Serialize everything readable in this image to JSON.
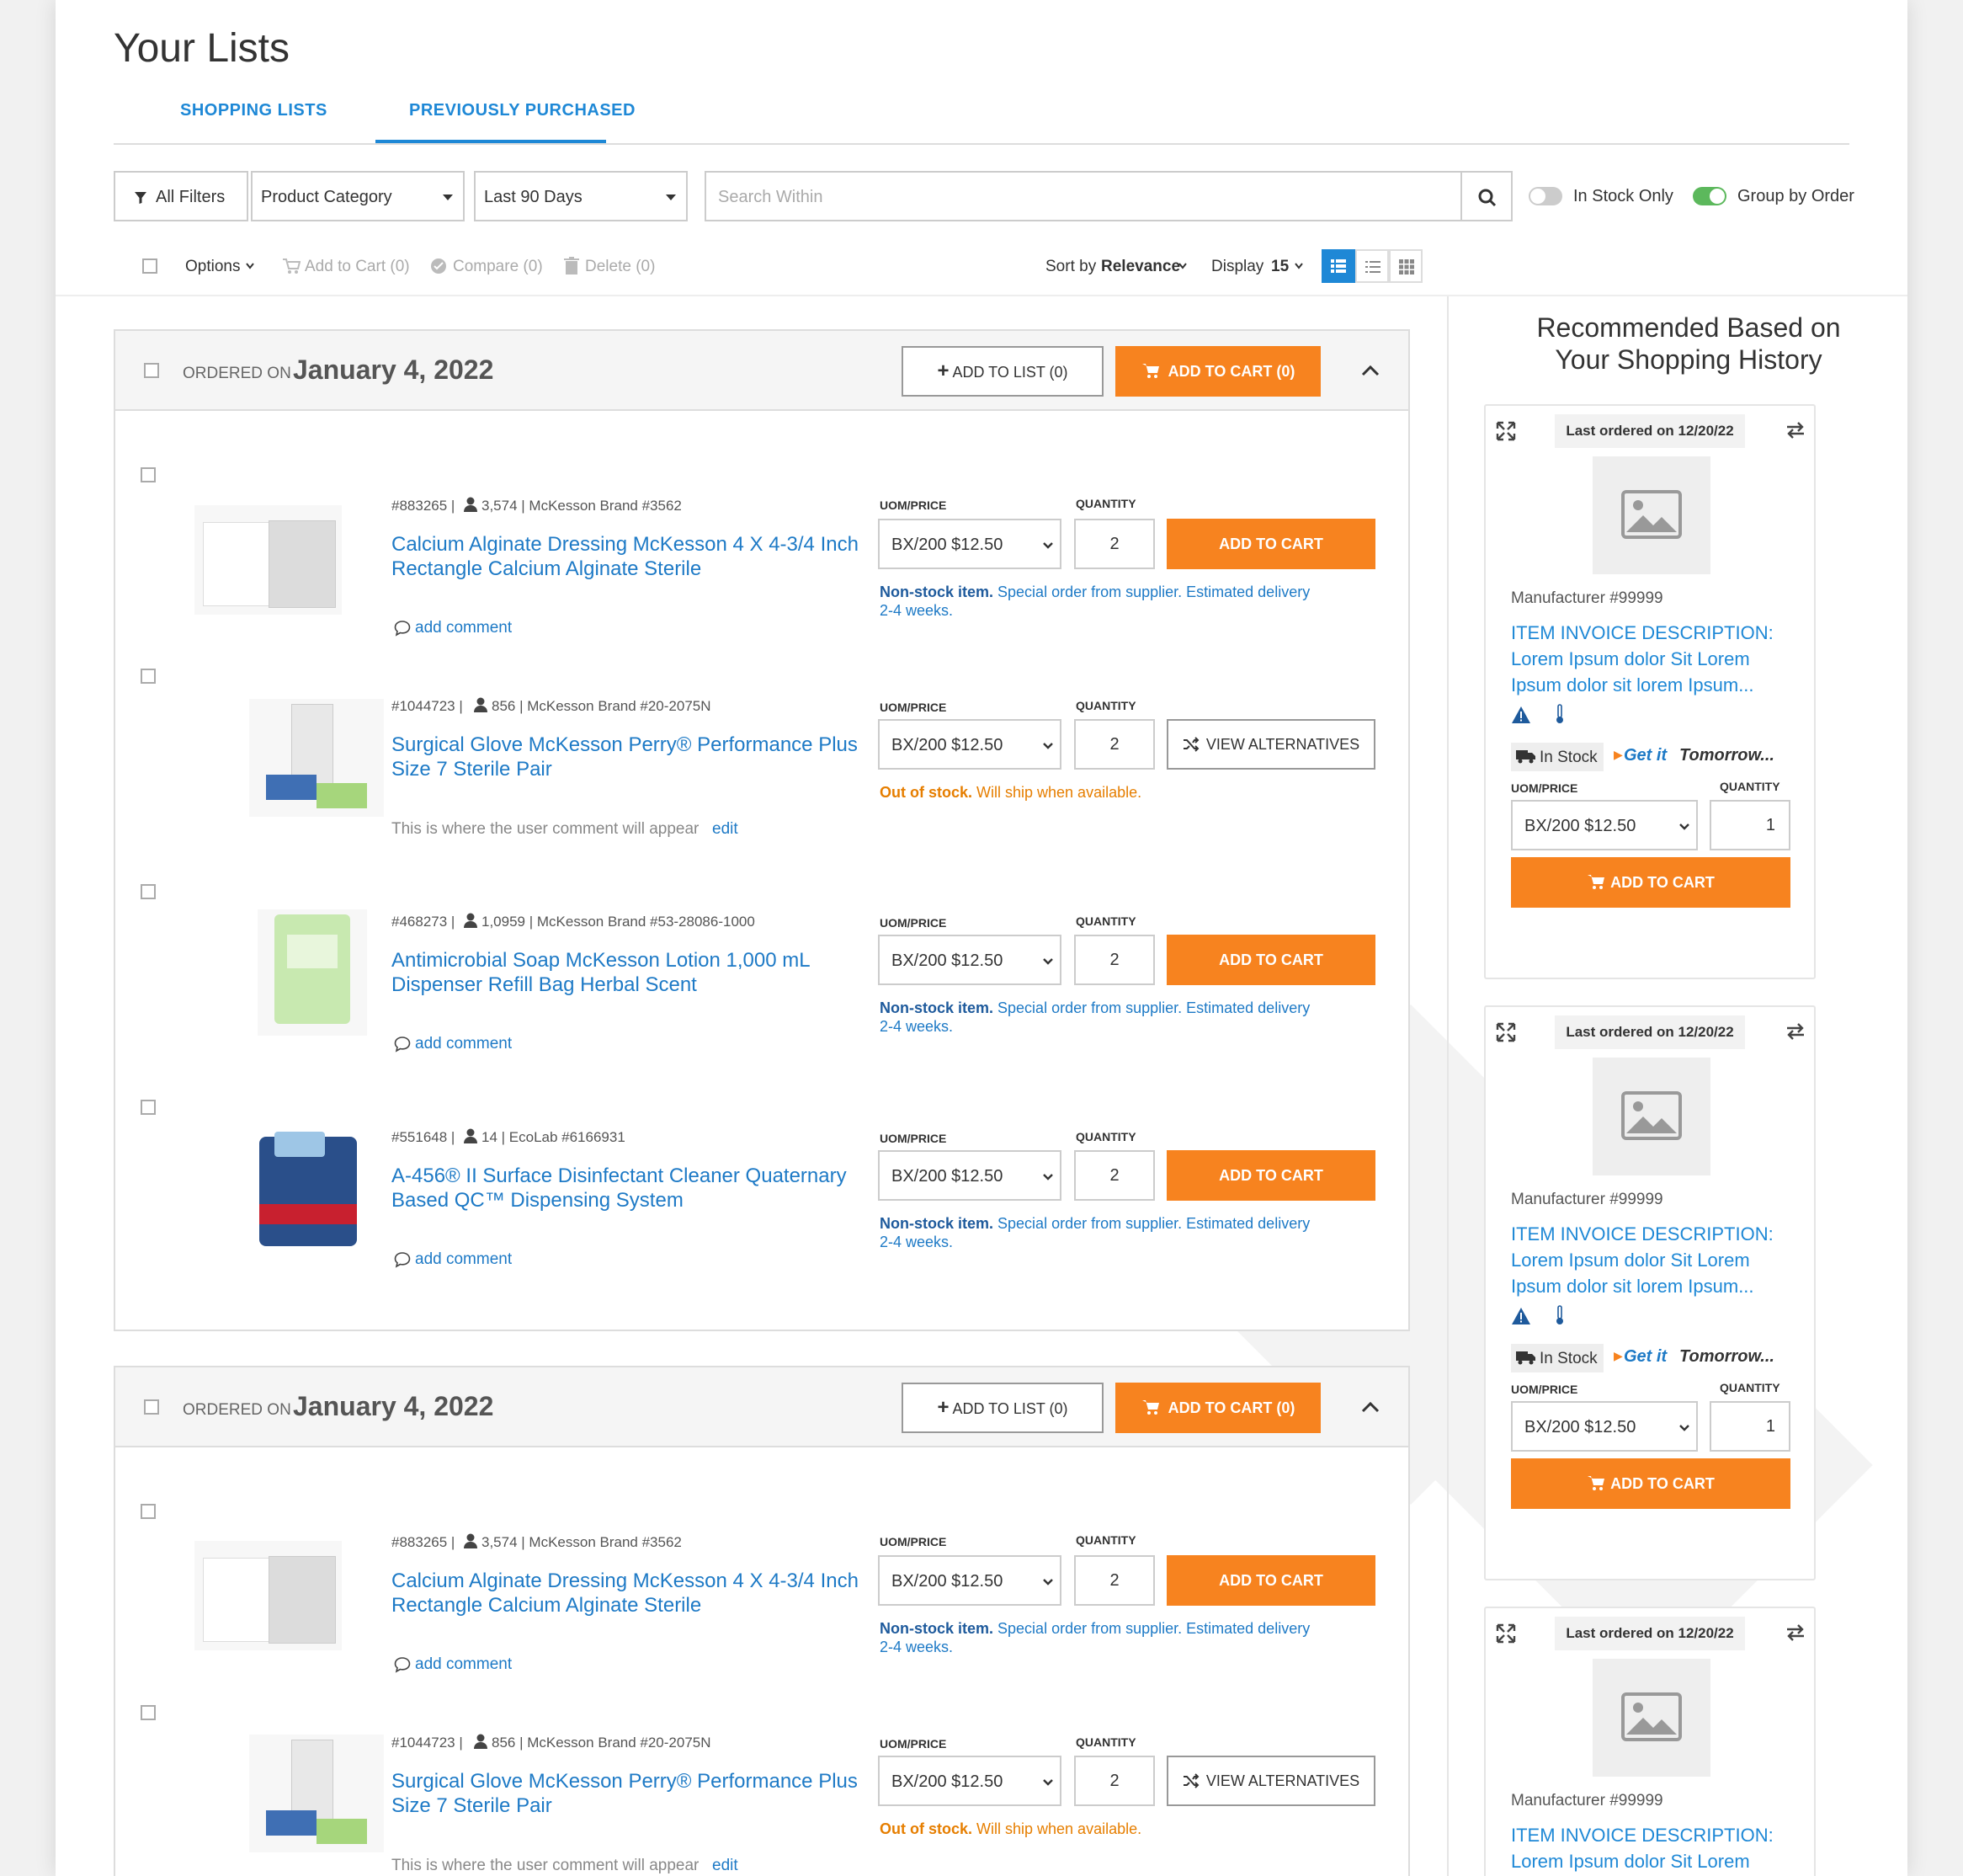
{
  "page": {
    "title": "Your Lists",
    "tabs": [
      {
        "label": "SHOPPING LISTS"
      },
      {
        "label": "PREVIOUSLY PURCHASED"
      }
    ]
  },
  "filters": {
    "all_filters": "All Filters",
    "category": "Product Category",
    "date_range": "Last 90 Days",
    "search_placeholder": "Search Within",
    "in_stock_only": "In Stock Only",
    "group_by_order": "Group by Order"
  },
  "toolbar": {
    "options": "Options",
    "add_to_cart": "Add to Cart (0)",
    "compare": "Compare (0)",
    "delete": "Delete (0)",
    "sort_label": "Sort by",
    "sort_value": "Relevance",
    "display_label": "Display",
    "display_value": "15"
  },
  "colors": {
    "accent": "#1e88d6",
    "orange": "#f7831f",
    "toggle_on": "#5cb85c",
    "out_of_stock": "#e67e00"
  },
  "common": {
    "uom_label": "UOM/PRICE",
    "qty_label": "QUANTITY",
    "add_to_cart": "ADD TO CART",
    "view_alternatives": "VIEW ALTERNATIVES",
    "add_comment": "add comment",
    "edit": "edit",
    "add_to_list": "ADD TO LIST (0)",
    "add_to_cart_group": "ADD TO CART (0)",
    "ordered_on": "ORDERED ON",
    "nonstock_bold": "Non-stock item.",
    "nonstock_rest": " Special order from supplier. Estimated delivery",
    "nonstock_weeks": "2-4 weeks.",
    "oos_bold": "Out of stock.",
    "oos_rest": " Will ship when available."
  },
  "groups": [
    {
      "date": "January 4, 2022",
      "items": [
        {
          "meta1": "#883265 |",
          "meta2": "3,574 | McKesson Brand #3562",
          "name1": "Calcium Alginate Dressing McKesson 4 X 4-3/4 Inch",
          "name2": "Rectangle Calcium Alginate Sterile",
          "uom": "BX/200 $12.50",
          "qty": "2"
        },
        {
          "meta1": "#1044723 |",
          "meta2": "856 | McKesson Brand #20-2075N",
          "name1": "Surgical Glove McKesson Perry® Performance Plus",
          "name2": "Size 7 Sterile Pair",
          "uom": "BX/200 $12.50",
          "qty": "2",
          "comment": "This is where the user comment will appear"
        },
        {
          "meta1": "#468273 |",
          "meta2": "1,0959 | McKesson Brand #53-28086-1000",
          "name1": "Antimicrobial Soap McKesson Lotion 1,000 mL",
          "name2": "Dispenser Refill Bag Herbal Scent",
          "uom": "BX/200 $12.50",
          "qty": "2"
        },
        {
          "meta1": "#551648 |",
          "meta2": "14 | EcoLab #6166931",
          "name1": "A-456® II Surface Disinfectant Cleaner Quaternary",
          "name2": "Based QC™ Dispensing System",
          "uom": "BX/200 $12.50",
          "qty": "2"
        }
      ]
    },
    {
      "date": "January 4, 2022",
      "items": [
        {
          "meta1": "#883265 |",
          "meta2": "3,574 | McKesson Brand #3562",
          "name1": "Calcium Alginate Dressing McKesson 4 X 4-3/4 Inch",
          "name2": "Rectangle Calcium Alginate Sterile",
          "uom": "BX/200 $12.50",
          "qty": "2"
        },
        {
          "meta1": "#1044723 |",
          "meta2": "856 | McKesson Brand #20-2075N",
          "name1": "Surgical Glove McKesson Perry® Performance Plus",
          "name2": "Size 7 Sterile Pair",
          "uom": "BX/200 $12.50",
          "qty": "2",
          "comment": "This is where the user comment will appear"
        }
      ]
    }
  ],
  "recommended": {
    "title1": "Recommended Based on",
    "title2": "Your Shopping History",
    "cards": [
      {
        "last_ordered": "Last ordered on 12/20/22",
        "manufacturer": "Manufacturer #99999",
        "desc1": "ITEM INVOICE DESCRIPTION:",
        "desc2": "Lorem Ipsum dolor Sit Lorem",
        "desc3": "Ipsum dolor sit lorem Ipsum...",
        "stock": "In Stock",
        "get_it": "Get it",
        "when": "Tomorrow...",
        "uom": "BX/200 $12.50",
        "qty": "1"
      },
      {
        "last_ordered": "Last ordered on 12/20/22",
        "manufacturer": "Manufacturer #99999",
        "desc1": "ITEM INVOICE DESCRIPTION:",
        "desc2": "Lorem Ipsum dolor Sit Lorem",
        "desc3": "Ipsum dolor sit lorem Ipsum...",
        "stock": "In Stock",
        "get_it": "Get it",
        "when": "Tomorrow...",
        "uom": "BX/200 $12.50",
        "qty": "1"
      },
      {
        "last_ordered": "Last ordered on 12/20/22",
        "manufacturer": "Manufacturer #99999",
        "desc1": "ITEM INVOICE DESCRIPTION:",
        "desc2": "Lorem Ipsum dolor Sit Lorem"
      }
    ]
  }
}
